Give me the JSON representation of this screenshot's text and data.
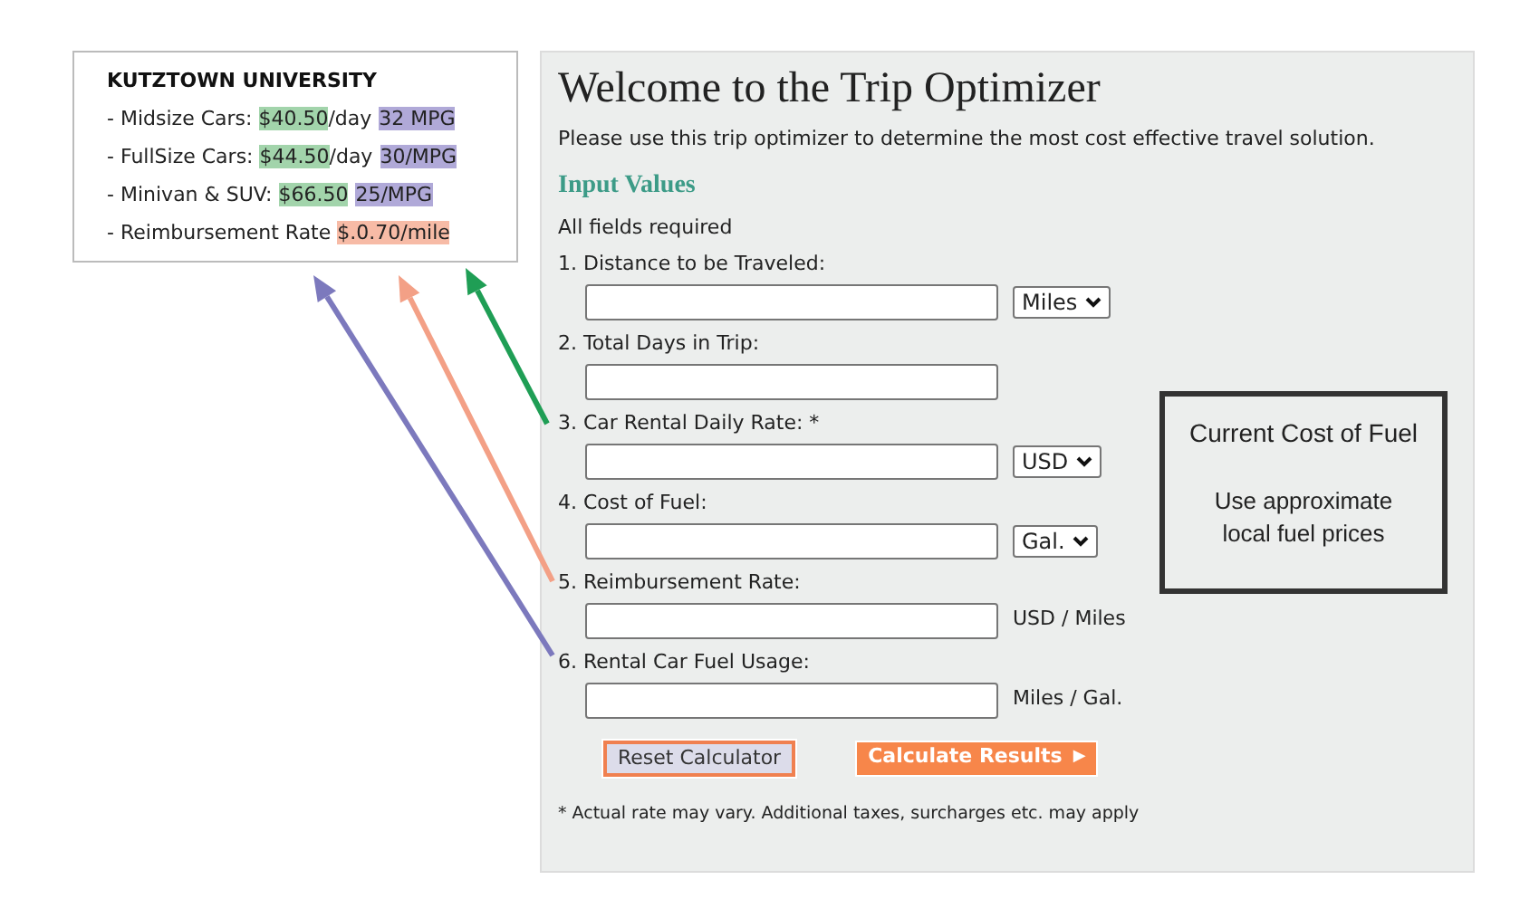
{
  "rates_card": {
    "title": "KUTZTOWN UNIVERSITY",
    "rows": [
      {
        "bullet": "-",
        "parts": [
          {
            "text": "Midsize Cars: "
          },
          {
            "text": "$40.50",
            "color": "#a2d4ab"
          },
          {
            "text": "/day"
          },
          {
            "text": "32 MPG",
            "color": "#b0a9d8"
          }
        ]
      },
      {
        "bullet": "-",
        "parts": [
          {
            "text": "FullSize Cars: "
          },
          {
            "text": "$44.50",
            "color": "#a2d4ab"
          },
          {
            "text": "/day"
          },
          {
            "text": "30/MPG",
            "color": "#b0a9d8"
          }
        ]
      },
      {
        "bullet": "-",
        "parts": [
          {
            "text": "Minivan & SUV: "
          },
          {
            "text": "$66.50",
            "color": "#a2d4ab"
          },
          {
            "text": "25/MPG",
            "color": "#b0a9d8"
          }
        ]
      },
      {
        "bullet": "-",
        "parts": [
          {
            "text": "Reimbursement Rate "
          },
          {
            "text": "$.0.70/mile",
            "color": "#f7bba6"
          }
        ]
      }
    ]
  },
  "main": {
    "title": "Welcome to the Trip Optimizer",
    "intro": "Please use this trip optimizer to determine the most cost effective travel solution.",
    "section": "Input Values",
    "required_note": "All fields required",
    "fields": [
      {
        "label": "1. Distance to be Traveled:",
        "unit": {
          "kind": "select",
          "value": "Miles"
        }
      },
      {
        "label": "2. Total Days in Trip:"
      },
      {
        "label": "3. Car Rental Daily Rate: *",
        "unit": {
          "kind": "select",
          "value": "USD"
        }
      },
      {
        "label": "4. Cost of Fuel:",
        "unit": {
          "kind": "select",
          "value": "Gal."
        }
      },
      {
        "label": "5. Reimbursement Rate:",
        "unit": {
          "kind": "text",
          "value": "USD / Miles"
        }
      },
      {
        "label": "6. Rental Car Fuel Usage:",
        "unit": {
          "kind": "text",
          "value": "Miles / Gal."
        }
      }
    ],
    "buttons": [
      {
        "label": "Reset Calculator",
        "kind": "reset"
      },
      {
        "label": "Calculate Results",
        "icon": "▶",
        "kind": "submit"
      }
    ],
    "footnote": "* Actual rate may vary. Additional taxes, surcharges etc. may apply",
    "fuel_box": {
      "title": "Current Cost of Fuel",
      "text": "Use approximate local fuel prices"
    }
  }
}
